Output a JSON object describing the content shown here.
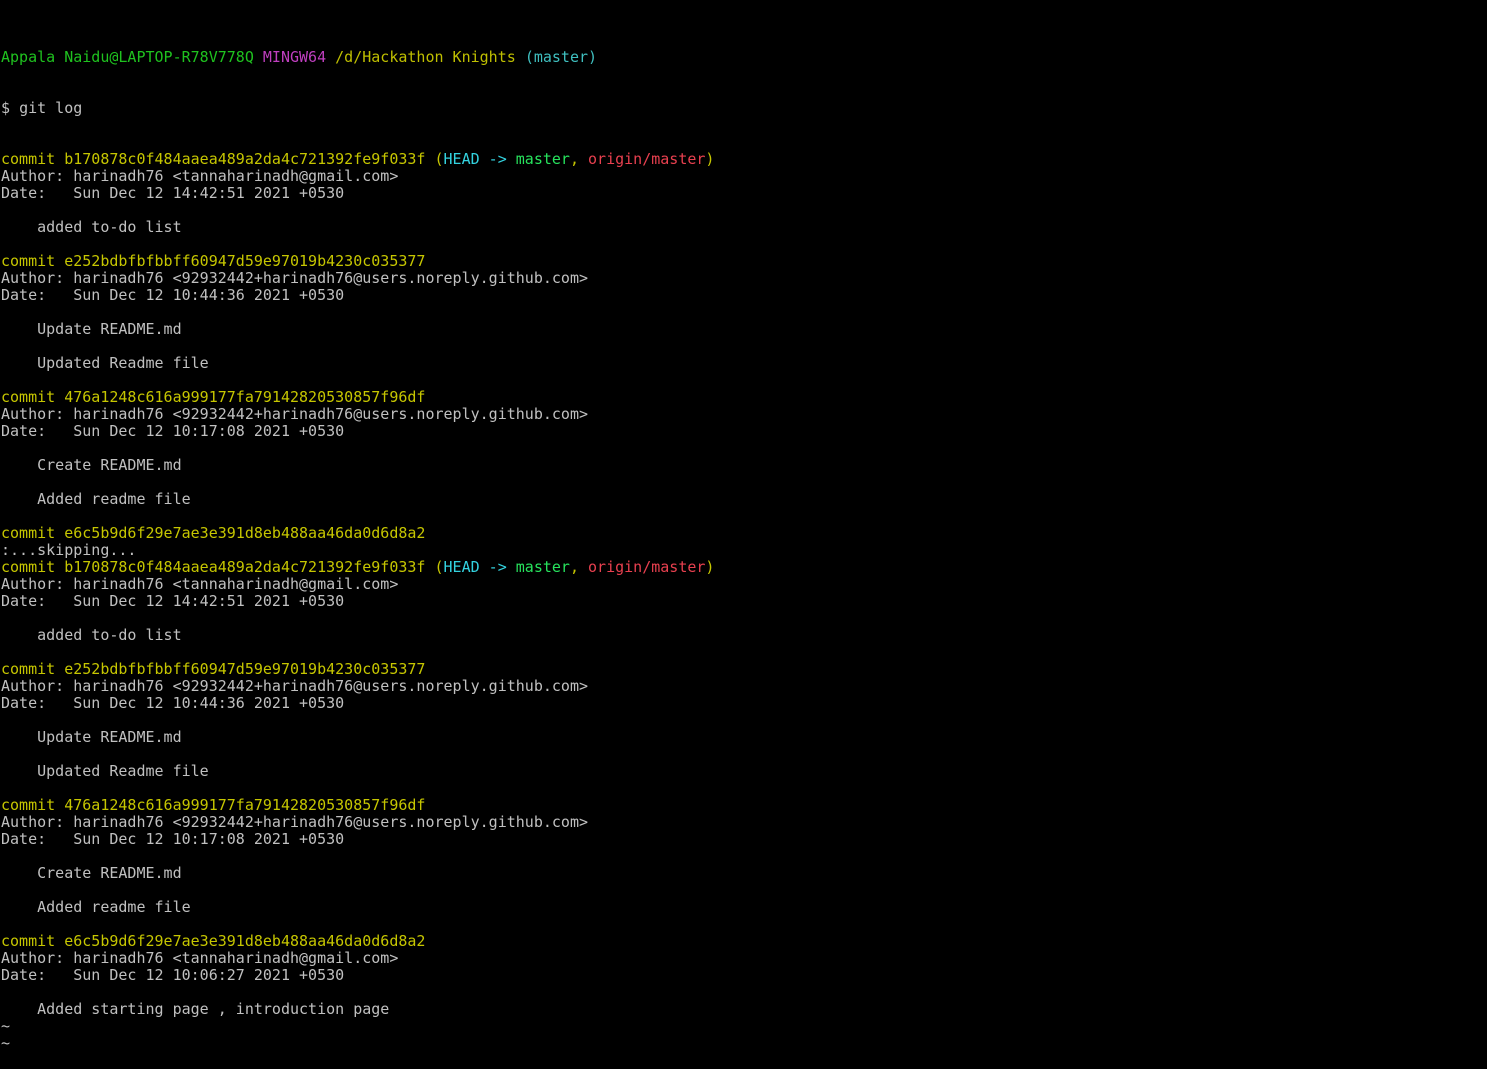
{
  "colors": {
    "background": "#000000",
    "default_text": "#c0c0c0",
    "prompt_user": "#1fc21f",
    "prompt_system": "#bf3fbf",
    "prompt_path": "#bfbf00",
    "prompt_branch": "#3fbfbf",
    "commit_hash": "#c6c600",
    "ref_head": "#33d3e0",
    "ref_local_branch": "#27e35d",
    "ref_remote_branch": "#e8404f"
  },
  "prompt": {
    "user_host": "Appala Naidu@LAPTOP-R78V778Q",
    "system": "MINGW64",
    "path": "/d/Hackathon Knights",
    "branch": "(master)",
    "symbol": "$",
    "command": "git log"
  },
  "lines": [
    {
      "kind": "commit",
      "hash": "b170878c0f484aaea489a2da4c721392fe9f033f",
      "refs": true
    },
    {
      "kind": "text",
      "text": "Author: harinadh76 <tannaharinadh@gmail.com>"
    },
    {
      "kind": "text",
      "text": "Date:   Sun Dec 12 14:42:51 2021 +0530"
    },
    {
      "kind": "text",
      "text": ""
    },
    {
      "kind": "text",
      "text": "    added to-do list"
    },
    {
      "kind": "text",
      "text": ""
    },
    {
      "kind": "commit",
      "hash": "e252bdbfbfbbff60947d59e97019b4230c035377",
      "refs": false
    },
    {
      "kind": "text",
      "text": "Author: harinadh76 <92932442+harinadh76@users.noreply.github.com>"
    },
    {
      "kind": "text",
      "text": "Date:   Sun Dec 12 10:44:36 2021 +0530"
    },
    {
      "kind": "text",
      "text": ""
    },
    {
      "kind": "text",
      "text": "    Update README.md"
    },
    {
      "kind": "text",
      "text": ""
    },
    {
      "kind": "text",
      "text": "    Updated Readme file"
    },
    {
      "kind": "text",
      "text": ""
    },
    {
      "kind": "commit",
      "hash": "476a1248c616a999177fa79142820530857f96df",
      "refs": false
    },
    {
      "kind": "text",
      "text": "Author: harinadh76 <92932442+harinadh76@users.noreply.github.com>"
    },
    {
      "kind": "text",
      "text": "Date:   Sun Dec 12 10:17:08 2021 +0530"
    },
    {
      "kind": "text",
      "text": ""
    },
    {
      "kind": "text",
      "text": "    Create README.md"
    },
    {
      "kind": "text",
      "text": ""
    },
    {
      "kind": "text",
      "text": "    Added readme file"
    },
    {
      "kind": "text",
      "text": ""
    },
    {
      "kind": "commit",
      "hash": "e6c5b9d6f29e7ae3e391d8eb488aa46da0d6d8a2",
      "refs": false
    },
    {
      "kind": "text",
      "text": ":...skipping..."
    },
    {
      "kind": "commit",
      "hash": "b170878c0f484aaea489a2da4c721392fe9f033f",
      "refs": true
    },
    {
      "kind": "text",
      "text": "Author: harinadh76 <tannaharinadh@gmail.com>"
    },
    {
      "kind": "text",
      "text": "Date:   Sun Dec 12 14:42:51 2021 +0530"
    },
    {
      "kind": "text",
      "text": ""
    },
    {
      "kind": "text",
      "text": "    added to-do list"
    },
    {
      "kind": "text",
      "text": ""
    },
    {
      "kind": "commit",
      "hash": "e252bdbfbfbbff60947d59e97019b4230c035377",
      "refs": false
    },
    {
      "kind": "text",
      "text": "Author: harinadh76 <92932442+harinadh76@users.noreply.github.com>"
    },
    {
      "kind": "text",
      "text": "Date:   Sun Dec 12 10:44:36 2021 +0530"
    },
    {
      "kind": "text",
      "text": ""
    },
    {
      "kind": "text",
      "text": "    Update README.md"
    },
    {
      "kind": "text",
      "text": ""
    },
    {
      "kind": "text",
      "text": "    Updated Readme file"
    },
    {
      "kind": "text",
      "text": ""
    },
    {
      "kind": "commit",
      "hash": "476a1248c616a999177fa79142820530857f96df",
      "refs": false
    },
    {
      "kind": "text",
      "text": "Author: harinadh76 <92932442+harinadh76@users.noreply.github.com>"
    },
    {
      "kind": "text",
      "text": "Date:   Sun Dec 12 10:17:08 2021 +0530"
    },
    {
      "kind": "text",
      "text": ""
    },
    {
      "kind": "text",
      "text": "    Create README.md"
    },
    {
      "kind": "text",
      "text": ""
    },
    {
      "kind": "text",
      "text": "    Added readme file"
    },
    {
      "kind": "text",
      "text": ""
    },
    {
      "kind": "commit",
      "hash": "e6c5b9d6f29e7ae3e391d8eb488aa46da0d6d8a2",
      "refs": false
    },
    {
      "kind": "text",
      "text": "Author: harinadh76 <tannaharinadh@gmail.com>"
    },
    {
      "kind": "text",
      "text": "Date:   Sun Dec 12 10:06:27 2021 +0530"
    },
    {
      "kind": "text",
      "text": ""
    },
    {
      "kind": "text",
      "text": "    Added starting page , introduction page"
    },
    {
      "kind": "text",
      "text": "~"
    },
    {
      "kind": "text",
      "text": "~"
    }
  ],
  "labels": {
    "commit_word": "commit",
    "refs": {
      "open": "(",
      "head": "HEAD",
      "arrow": "->",
      "local": "master",
      "sep": ",",
      "remote": "origin/master",
      "close": ")"
    }
  }
}
